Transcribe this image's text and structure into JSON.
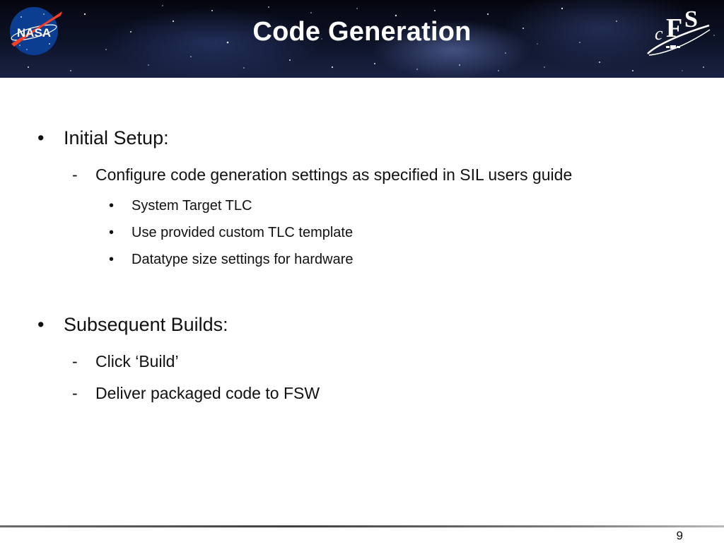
{
  "slide": {
    "title": "Code Generation",
    "logos": {
      "left": "NASA",
      "right": "CFS"
    },
    "sections": [
      {
        "bullet": "•",
        "label": "Initial Setup:",
        "items": [
          {
            "bullet": "-",
            "label": "Configure code generation settings as specified in SIL users guide",
            "subitems": [
              {
                "bullet": "•",
                "label": "System Target TLC"
              },
              {
                "bullet": "•",
                "label": "Use provided custom TLC template"
              },
              {
                "bullet": "•",
                "label": "Datatype size settings for hardware"
              }
            ]
          }
        ]
      },
      {
        "bullet": "•",
        "label": "Subsequent Builds:",
        "items": [
          {
            "bullet": "-",
            "label": "Click ‘Build’"
          },
          {
            "bullet": "-",
            "label": "Deliver packaged code to FSW"
          }
        ]
      }
    ],
    "page_number": "9",
    "colors": {
      "header_bg": "#0d1328",
      "title_text": "#ffffff",
      "nasa_blue": "#0b3d91",
      "nasa_red": "#fc3d21",
      "body_text": "#111111"
    }
  }
}
